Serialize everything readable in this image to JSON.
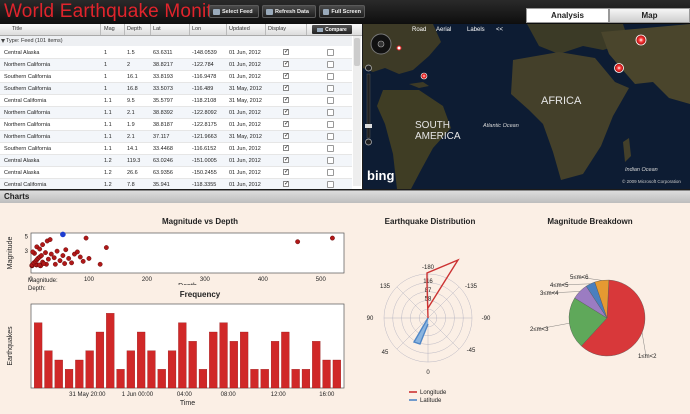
{
  "header": {
    "title": "World Earthquake Monitor",
    "buttons": [
      {
        "label": "Select Feed",
        "icon": "feed-icon"
      },
      {
        "label": "Refresh Data",
        "icon": "refresh-icon"
      },
      {
        "label": "Full Screen",
        "icon": "fullscreen-icon"
      }
    ],
    "tabs": [
      {
        "label": "Analysis",
        "active": true
      },
      {
        "label": "Map",
        "active": false
      }
    ]
  },
  "table": {
    "columns": [
      "Title",
      "Mag",
      "Depth",
      "Lat",
      "Lon",
      "Updated",
      "Display"
    ],
    "compare_label": "Compare",
    "group_label": "Type: Feed (101 items)",
    "rows": [
      {
        "title": "Central Alaska",
        "mag": "1",
        "depth": "1.5",
        "lat": "63.6311",
        "lon": "-148.0539",
        "updated": "01 Jun, 2012",
        "display": true
      },
      {
        "title": "Northern California",
        "mag": "1",
        "depth": "2",
        "lat": "38.8217",
        "lon": "-122.784",
        "updated": "01 Jun, 2012",
        "display": true
      },
      {
        "title": "Southern California",
        "mag": "1",
        "depth": "16.1",
        "lat": "33.8193",
        "lon": "-116.9478",
        "updated": "01 Jun, 2012",
        "display": true
      },
      {
        "title": "Southern California",
        "mag": "1",
        "depth": "16.8",
        "lat": "33.5073",
        "lon": "-116.489",
        "updated": "31 May, 2012",
        "display": true
      },
      {
        "title": "Central California",
        "mag": "1.1",
        "depth": "9.5",
        "lat": "35.5797",
        "lon": "-118.2108",
        "updated": "31 May, 2012",
        "display": true
      },
      {
        "title": "Northern California",
        "mag": "1.1",
        "depth": "2.1",
        "lat": "38.8392",
        "lon": "-122.8092",
        "updated": "01 Jun, 2012",
        "display": true
      },
      {
        "title": "Northern California",
        "mag": "1.1",
        "depth": "1.9",
        "lat": "38.8187",
        "lon": "-122.8175",
        "updated": "01 Jun, 2012",
        "display": true
      },
      {
        "title": "Northern California",
        "mag": "1.1",
        "depth": "2.1",
        "lat": "37.117",
        "lon": "-121.9663",
        "updated": "31 May, 2012",
        "display": true
      },
      {
        "title": "Southern California",
        "mag": "1.1",
        "depth": "14.1",
        "lat": "33.4468",
        "lon": "-116.6152",
        "updated": "01 Jun, 2012",
        "display": true
      },
      {
        "title": "Central Alaska",
        "mag": "1.2",
        "depth": "119.3",
        "lat": "63.0246",
        "lon": "-151.0005",
        "updated": "01 Jun, 2012",
        "display": true
      },
      {
        "title": "Central Alaska",
        "mag": "1.2",
        "depth": "26.6",
        "lat": "63.9356",
        "lon": "-150.2455",
        "updated": "01 Jun, 2012",
        "display": true
      },
      {
        "title": "Central California",
        "mag": "1.2",
        "depth": "7.8",
        "lat": "35.941",
        "lon": "-118.3355",
        "updated": "01 Jun, 2012",
        "display": true
      }
    ]
  },
  "map": {
    "controls": [
      "Road",
      "Aerial",
      "Labels",
      "<<"
    ],
    "labels": {
      "africa": "AFRICA",
      "south_america": "SOUTH\nAMERICA",
      "atlantic": "Atlantic Ocean",
      "indian": "Indian Ocean"
    },
    "logo": "bing",
    "copyright": "© 2009 Microsoft Corporation",
    "colors": {
      "water": "#0d1c33",
      "land": "#3b3a25",
      "marker": "#e03030"
    }
  },
  "charts": {
    "section_label": "Charts",
    "readout": {
      "magnitude_label": "Magnitude:",
      "depth_label": "Depth:"
    },
    "accent": "#c41e1e"
  },
  "chart_data": [
    {
      "type": "scatter",
      "title": "Magnitude vs Depth",
      "xlabel": "Depth",
      "ylabel": "Magnitude",
      "xlim": [
        0,
        540
      ],
      "ylim": [
        0,
        5.5
      ],
      "xticks": [
        0,
        100,
        200,
        300,
        400,
        500
      ],
      "yticks": [
        3,
        5
      ],
      "points": [
        [
          1.5,
          1
        ],
        [
          2,
          1
        ],
        [
          16.1,
          1
        ],
        [
          16.8,
          1
        ],
        [
          9.5,
          1.1
        ],
        [
          2.1,
          1.1
        ],
        [
          1.9,
          1.1
        ],
        [
          14.1,
          1.1
        ],
        [
          119.3,
          1.2
        ],
        [
          26.6,
          1.2
        ],
        [
          7.8,
          1.2
        ],
        [
          5,
          1.4
        ],
        [
          8,
          1.6
        ],
        [
          10,
          1.8
        ],
        [
          12,
          2.0
        ],
        [
          15,
          2.2
        ],
        [
          18,
          2.4
        ],
        [
          20,
          1.5
        ],
        [
          25,
          2.8
        ],
        [
          30,
          1.9
        ],
        [
          35,
          2.6
        ],
        [
          40,
          2.1
        ],
        [
          45,
          3.0
        ],
        [
          50,
          1.7
        ],
        [
          55,
          2.4
        ],
        [
          60,
          3.2
        ],
        [
          65,
          2.0
        ],
        [
          70,
          1.4
        ],
        [
          75,
          2.6
        ],
        [
          80,
          2.9
        ],
        [
          85,
          2.2
        ],
        [
          90,
          1.6
        ],
        [
          10,
          3.6
        ],
        [
          15,
          3.3
        ],
        [
          20,
          3.9
        ],
        [
          28,
          4.4
        ],
        [
          33,
          4.6
        ],
        [
          95,
          4.8
        ],
        [
          130,
          3.5
        ],
        [
          6,
          2.7
        ],
        [
          3,
          2.9
        ],
        [
          22,
          1.3
        ],
        [
          42,
          1.2
        ],
        [
          58,
          1.3
        ],
        [
          100,
          2.0
        ],
        [
          460,
          4.3
        ],
        [
          520,
          4.8
        ]
      ],
      "highlight": [
        55,
        5.3
      ],
      "grid": false
    },
    {
      "type": "bar",
      "title": "Frequency",
      "xlabel": "Time",
      "ylabel": "Earthquakes",
      "xticks": [
        "31 May 20:00",
        "1 Jun 00:00",
        "04:00",
        "08:00",
        "12:00",
        "16:00"
      ],
      "values": [
        7,
        4,
        3,
        2,
        3,
        4,
        6,
        8,
        2,
        4,
        6,
        4,
        2,
        4,
        7,
        5,
        2,
        6,
        7,
        5,
        6,
        2,
        2,
        5,
        6,
        2,
        2,
        5,
        3,
        3
      ],
      "ylim": [
        0,
        9
      ],
      "grid": false
    },
    {
      "type": "polar",
      "title": "Earthquake Distribution",
      "angle_labels": [
        "-180",
        "-135",
        "-90",
        "-45",
        "0",
        "45",
        "90",
        "135"
      ],
      "radial_ticks": [
        116,
        87,
        58
      ],
      "series": [
        {
          "name": "Longitude"
        },
        {
          "name": "Latitude"
        }
      ],
      "legend": "bottom"
    },
    {
      "type": "pie",
      "title": "Magnitude Breakdown",
      "slices": [
        {
          "label": "1≤m<2",
          "value": 61,
          "color": "#d8383a"
        },
        {
          "label": "2≤m<3",
          "value": 22,
          "color": "#5fa85a"
        },
        {
          "label": "3≤m<4",
          "value": 7,
          "color": "#9b7cc2"
        },
        {
          "label": "4≤m<5",
          "value": 4,
          "color": "#4a7fbf"
        },
        {
          "label": "5≤m<6",
          "value": 6,
          "color": "#e59a32"
        }
      ]
    }
  ]
}
